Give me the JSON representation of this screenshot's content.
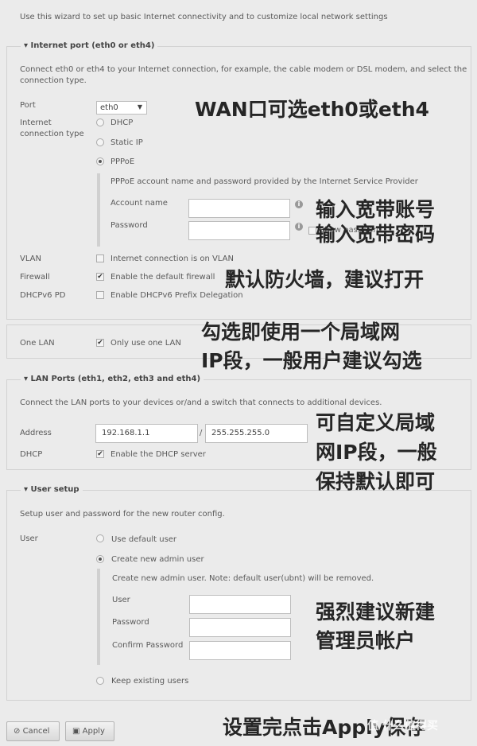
{
  "intro": "Use this wizard to set up basic Internet connectivity and to customize local network settings",
  "internet": {
    "legend": "Internet port (eth0 or eth4)",
    "desc1": "Connect eth0 or eth4 to your Internet connection, for example, the cable modem or DSL modem, and select the",
    "desc2": "connection type.",
    "port_label": "Port",
    "port_value": "eth0",
    "type_label1": "Internet",
    "type_label2": "connection type",
    "types": [
      "DHCP",
      "Static IP",
      "PPPoE"
    ],
    "selected_type": "PPPoE",
    "pppoe_desc": "PPPoE account name and password provided by the Internet Service Provider",
    "account_label": "Account name",
    "account_value": "",
    "password_label": "Password",
    "password_value": "",
    "show_password": "Show password",
    "vlan_label": "VLAN",
    "vlan_text": "Internet connection is on VLAN",
    "vlan_checked": false,
    "firewall_label": "Firewall",
    "firewall_text": "Enable the default firewall",
    "firewall_checked": true,
    "dhcpv6_label": "DHCPv6 PD",
    "dhcpv6_text": "Enable DHCPv6 Prefix Delegation",
    "dhcpv6_checked": false
  },
  "one_lan": {
    "label": "One LAN",
    "text": "Only use one LAN",
    "checked": true
  },
  "lan": {
    "legend": "LAN Ports (eth1, eth2, eth3 and eth4)",
    "desc": "Connect the LAN ports to your devices or/and a switch that connects to additional devices.",
    "address_label": "Address",
    "address": "192.168.1.1",
    "separator": "/",
    "netmask": "255.255.255.0",
    "dhcp_label": "DHCP",
    "dhcp_text": "Enable the DHCP server",
    "dhcp_checked": true
  },
  "user": {
    "legend": "User setup",
    "desc": "Setup user and password for the new router config.",
    "label": "User",
    "options": [
      "Use default user",
      "Create new admin user",
      "Keep existing users"
    ],
    "selected": "Create new admin user",
    "note": "Create new admin user. Note: default user(ubnt) will be removed.",
    "user_label": "User",
    "password_label": "Password",
    "confirm_label": "Confirm Password"
  },
  "buttons": {
    "cancel": "Cancel",
    "apply": "Apply"
  },
  "annotations": {
    "wan": "WAN口可选eth0或eth4",
    "account": "输入宽带账号",
    "password": "输入宽带密码",
    "firewall": "默认防火墙，建议打开",
    "onelan1": "勾选即使用一个局域网",
    "onelan2": "IP段，一般用户建议勾选",
    "lan1": "可自定义局域",
    "lan2": "网IP段，一般",
    "lan3": "保持默认即可",
    "admin1": "强烈建议新建",
    "admin2": "管理员帐户",
    "apply": "设置完点击Apply保存"
  },
  "watermark": "值 什么值得买"
}
